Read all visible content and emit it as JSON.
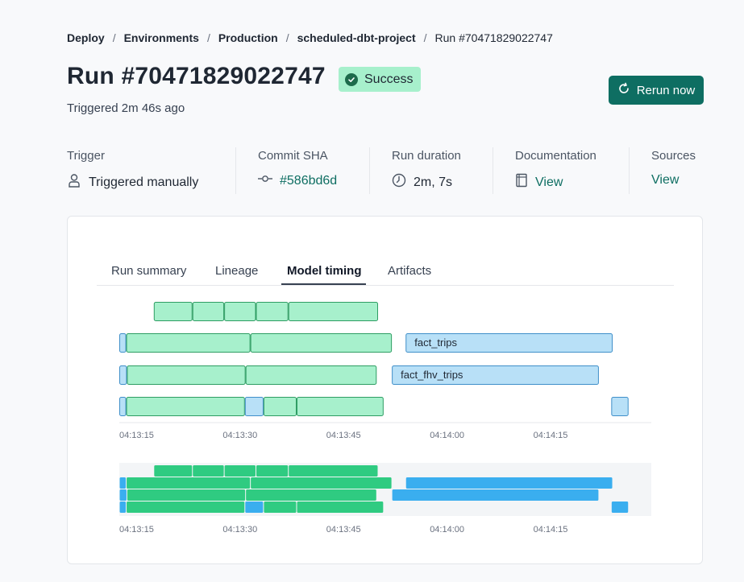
{
  "breadcrumb": {
    "items": [
      "Deploy",
      "Environments",
      "Production",
      "scheduled-dbt-project",
      "Run #70471829022747"
    ],
    "separator": "/"
  },
  "header": {
    "title": "Run #70471829022747",
    "status": "Success",
    "subtitle": "Triggered 2m 46s ago",
    "rerun_label": "Rerun now"
  },
  "meta": {
    "trigger_label": "Trigger",
    "trigger_value": "Triggered manually",
    "commit_label": "Commit SHA",
    "commit_value": "#586bd6d",
    "duration_label": "Run duration",
    "duration_value": "2m, 7s",
    "docs_label": "Documentation",
    "docs_value": "View",
    "sources_label": "Sources",
    "sources_value": "View"
  },
  "tabs": [
    "Run summary",
    "Lineage",
    "Model timing",
    "Artifacts"
  ],
  "active_tab": "Model timing",
  "colors": {
    "accent": "#0e6e62",
    "model_fill": "#a7f0cc",
    "model_stroke": "#2e9d63",
    "other_fill": "#b8e0f7",
    "other_stroke": "#3f8fc9",
    "model_overview": "#2fcb81",
    "other_overview": "#3aaeef",
    "badge_bg": "#a7f0cc"
  },
  "chart_data": {
    "type": "gantt",
    "x_ticks": [
      "04:13:15",
      "04:13:30",
      "04:13:45",
      "04:14:00",
      "04:14:15"
    ],
    "rows": [
      [
        {
          "start": 20,
          "end": 25.6,
          "kind": "model"
        },
        {
          "start": 25.6,
          "end": 30.2,
          "kind": "model"
        },
        {
          "start": 30.2,
          "end": 34.8,
          "kind": "model"
        },
        {
          "start": 34.8,
          "end": 39.5,
          "kind": "model"
        },
        {
          "start": 39.5,
          "end": 52.5,
          "kind": "model"
        }
      ],
      [
        {
          "start": 15,
          "end": 16,
          "kind": "other"
        },
        {
          "start": 16,
          "end": 34,
          "kind": "model"
        },
        {
          "start": 34,
          "end": 54.5,
          "kind": "model"
        },
        {
          "start": 56.5,
          "end": 86.5,
          "kind": "other",
          "label": "fact_trips"
        }
      ],
      [
        {
          "start": 15,
          "end": 16.1,
          "kind": "other"
        },
        {
          "start": 16.1,
          "end": 33.3,
          "kind": "model"
        },
        {
          "start": 33.3,
          "end": 52.3,
          "kind": "model"
        },
        {
          "start": 54.5,
          "end": 84.5,
          "kind": "other",
          "label": "fact_fhv_trips"
        }
      ],
      [
        {
          "start": 15,
          "end": 16,
          "kind": "other"
        },
        {
          "start": 16,
          "end": 33.2,
          "kind": "model"
        },
        {
          "start": 33.2,
          "end": 35.9,
          "kind": "other"
        },
        {
          "start": 35.9,
          "end": 40.7,
          "kind": "model"
        },
        {
          "start": 40.7,
          "end": 53.3,
          "kind": "model"
        },
        {
          "start": 86.3,
          "end": 88.8,
          "kind": "other"
        }
      ]
    ]
  }
}
